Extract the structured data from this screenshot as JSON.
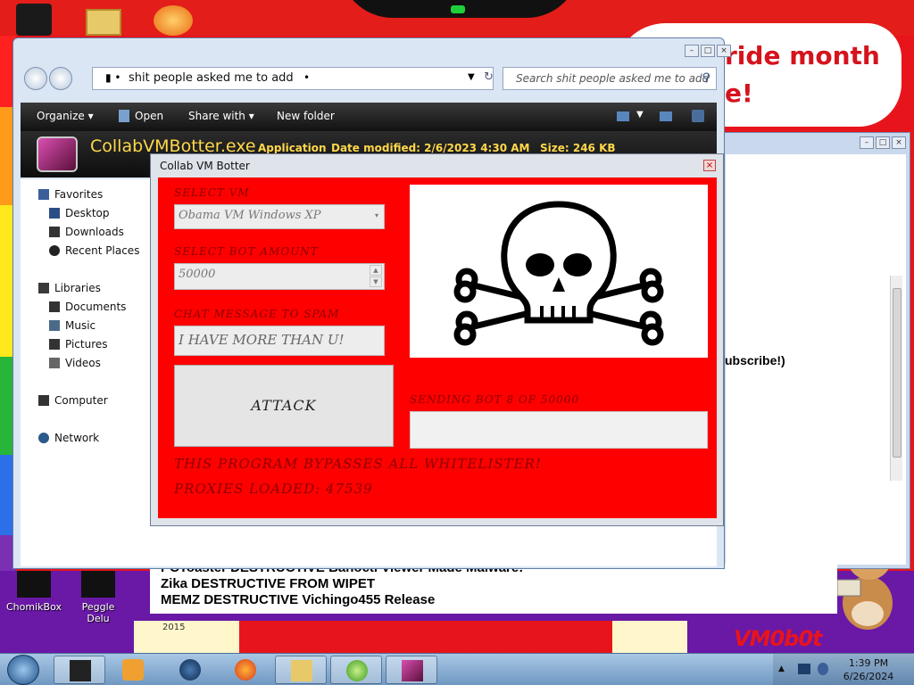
{
  "desktop": {
    "cloud_line1": "ride month",
    "cloud_line2": "e!",
    "icons": [
      {
        "label": "ChomikBox"
      },
      {
        "label": "Peggle Delu"
      }
    ],
    "year_label": "2015",
    "watermark": "VM0b0t"
  },
  "background_window": {
    "subscribe_text": "ubscribe!)",
    "list_lines": [
      "PCToaster DESTRUCTIVE Banocti Viewer Made Malware!",
      "Zika DESTRUCTIVE FROM WIPET",
      "MEMZ DESTRUCTIVE Vichingo455 Release"
    ]
  },
  "explorer": {
    "address": "shit people asked me to add",
    "search_placeholder": "Search shit people asked me to add",
    "toolbar": {
      "organize": "Organize",
      "open": "Open",
      "share_with": "Share with",
      "new_folder": "New folder"
    },
    "details": {
      "file_name": "CollabVMBotter.exe",
      "type": "Application",
      "date_modified": "Date modified: 2/6/2023 4:30 AM",
      "size": "Size: 246 KB"
    },
    "nav": {
      "favorites": "Favorites",
      "desktop": "Desktop",
      "downloads": "Downloads",
      "recent_places": "Recent Places",
      "libraries": "Libraries",
      "documents": "Documents",
      "music": "Music",
      "pictures": "Pictures",
      "videos": "Videos",
      "computer": "Computer",
      "network": "Network"
    }
  },
  "botter": {
    "title": "Collab VM Botter",
    "select_vm_label": "SELECT VM",
    "select_vm_value": "Obama VM Windows XP",
    "bot_amount_label": "SELECT BOT AMOUNT",
    "bot_amount_value": "50000",
    "chat_label": "CHAT MESSAGE TO SPAM",
    "chat_value": "I HAVE MORE THAN U!",
    "attack_label": "ATTACK",
    "sending_label": "SENDING BOT 8 OF 50000",
    "progress": 0.0002,
    "bypass_text": "THIS PROGRAM BYPASSES ALL WHITELISTER!",
    "proxies_text": "PROXIES LOADED: 47539"
  },
  "taskbar": {
    "time": "1:39 PM",
    "date": "6/26/2024"
  }
}
